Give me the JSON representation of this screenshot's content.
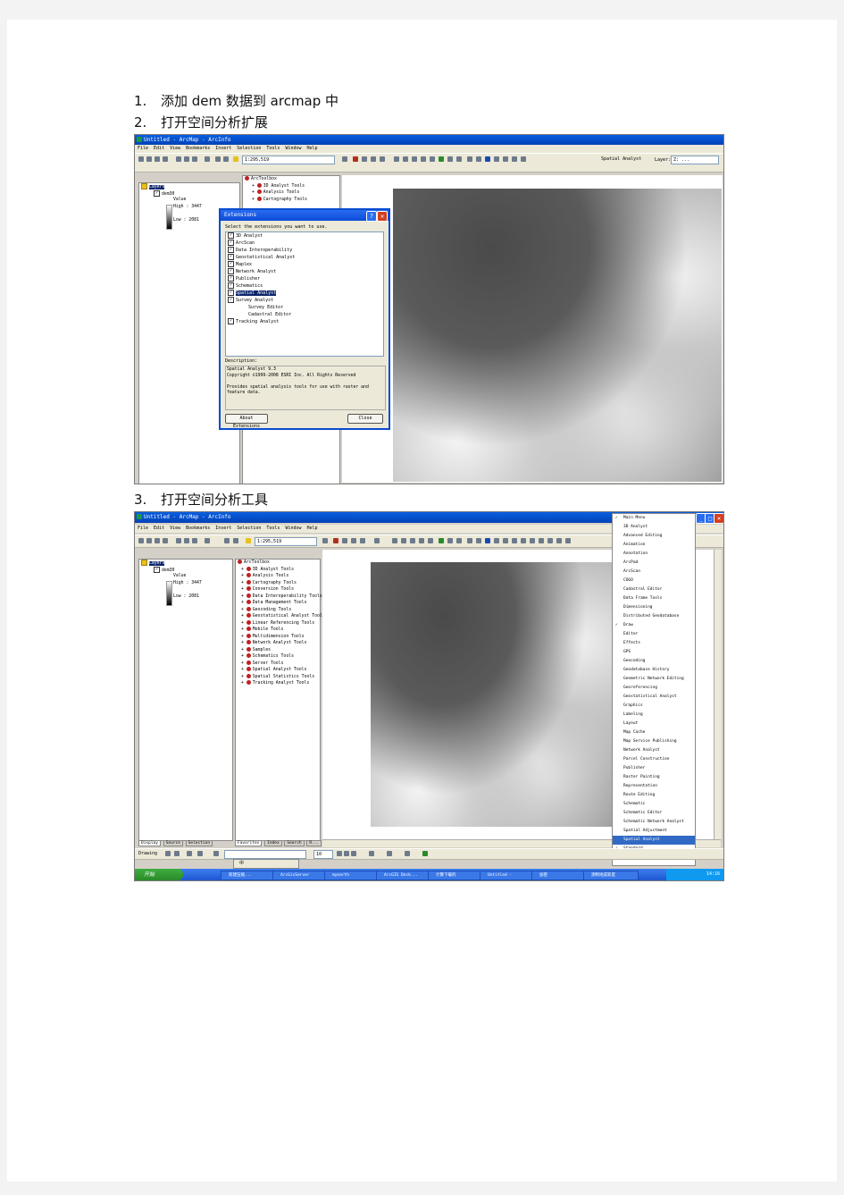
{
  "steps": [
    {
      "num": "1.",
      "text": "添加 dem 数据到 arcmap 中"
    },
    {
      "num": "2.",
      "text": "打开空间分析扩展"
    },
    {
      "num": "3.",
      "text": "打开空间分析工具"
    }
  ],
  "shot1": {
    "title": "Untitled - ArcMap - ArcInfo",
    "menu": [
      "File",
      "Edit",
      "View",
      "Bookmarks",
      "Insert",
      "Selection",
      "Tools",
      "Window",
      "Help"
    ],
    "scale": "1:295,519",
    "spatial_analyst_label": "Spatial Analyst",
    "layer_label": "Layer:",
    "layer_value": "Z: ...",
    "toc": {
      "root": "Layers",
      "layer": "dem30",
      "value_label": "Value",
      "high": "High : 3447",
      "low": "Low : 2081"
    },
    "toolbox": {
      "root": "ArcToolbox",
      "items": [
        "3D Analyst Tools",
        "Analysis Tools",
        "Cartography Tools"
      ]
    },
    "dialog": {
      "title": "Extensions",
      "prompt": "Select the extensions you want to use.",
      "extensions": [
        {
          "label": "3D Analyst",
          "checked": true,
          "indent": 0
        },
        {
          "label": "ArcScan",
          "checked": true,
          "indent": 0
        },
        {
          "label": "Data Interoperability",
          "checked": true,
          "indent": 0
        },
        {
          "label": "Geostatistical Analyst",
          "checked": true,
          "indent": 0
        },
        {
          "label": "Maplex",
          "checked": true,
          "indent": 0
        },
        {
          "label": "Network Analyst",
          "checked": true,
          "indent": 0
        },
        {
          "label": "Publisher",
          "checked": true,
          "indent": 0
        },
        {
          "label": "Schematics",
          "checked": true,
          "indent": 0
        },
        {
          "label": "Spatial Analyst",
          "checked": true,
          "indent": 0,
          "selected": true
        },
        {
          "label": "Survey Analyst",
          "checked": true,
          "indent": 0
        },
        {
          "label": "Survey Editor",
          "checked": false,
          "indent": 1
        },
        {
          "label": "Cadastral Editor",
          "checked": false,
          "indent": 1
        },
        {
          "label": "Tracking Analyst",
          "checked": true,
          "indent": 0
        }
      ],
      "description_label": "Description:",
      "description_lines": [
        "Spatial Analyst 9.3",
        "Copyright ©1999-2008 ESRI Inc. All Rights Reserved",
        "",
        "Provides spatial analysis tools for use with raster and feature data."
      ],
      "about_button": "About Extensions",
      "close_button": "Close"
    }
  },
  "shot2": {
    "title": "Untitled - ArcMap - ArcInfo",
    "menu": [
      "File",
      "Edit",
      "View",
      "Bookmarks",
      "Insert",
      "Selection",
      "Tools",
      "Window",
      "Help"
    ],
    "scale": "1:295,519",
    "toc": {
      "root": "Layers",
      "layer": "dem30",
      "value_label": "Value",
      "high": "High : 3447",
      "low": "Low : 2081"
    },
    "toc_tabs": [
      "Display",
      "Source",
      "Selection"
    ],
    "toolbox": {
      "root": "ArcToolbox",
      "items": [
        "3D Analyst Tools",
        "Analysis Tools",
        "Cartography Tools",
        "Conversion Tools",
        "Data Interoperability Tools",
        "Data Management Tools",
        "Geocoding Tools",
        "Geostatistical Analyst Tools",
        "Linear Referencing Tools",
        "Mobile Tools",
        "Multidimension Tools",
        "Network Analyst Tools",
        "Samples",
        "Schematics Tools",
        "Server Tools",
        "Spatial Analyst Tools",
        "Spatial Statistics Tools",
        "Tracking Analyst Tools"
      ]
    },
    "toolbox_tabs": [
      "Favorites",
      "Index",
      "Search",
      "R..."
    ],
    "toolbar_menu": [
      {
        "label": "Main Menu",
        "checked": true
      },
      {
        "label": "3D Analyst",
        "checked": false
      },
      {
        "label": "Advanced Editing",
        "checked": false
      },
      {
        "label": "Animation",
        "checked": false
      },
      {
        "label": "Annotation",
        "checked": false
      },
      {
        "label": "ArcPad",
        "checked": false
      },
      {
        "label": "ArcScan",
        "checked": false
      },
      {
        "label": "COGO",
        "checked": false
      },
      {
        "label": "Cadastral Editor",
        "checked": false
      },
      {
        "label": "Data Frame Tools",
        "checked": false
      },
      {
        "label": "Dimensioning",
        "checked": false
      },
      {
        "label": "Distributed Geodatabase",
        "checked": false
      },
      {
        "label": "Draw",
        "checked": true
      },
      {
        "label": "Editor",
        "checked": false
      },
      {
        "label": "Effects",
        "checked": false
      },
      {
        "label": "GPS",
        "checked": false
      },
      {
        "label": "Geocoding",
        "checked": false
      },
      {
        "label": "Geodatabase History",
        "checked": false
      },
      {
        "label": "Geometric Network Editing",
        "checked": false
      },
      {
        "label": "Georeferencing",
        "checked": false
      },
      {
        "label": "Geostatistical Analyst",
        "checked": false
      },
      {
        "label": "Graphics",
        "checked": false
      },
      {
        "label": "Labeling",
        "checked": false
      },
      {
        "label": "Layout",
        "checked": false
      },
      {
        "label": "Map Cache",
        "checked": false
      },
      {
        "label": "Map Service Publishing",
        "checked": false
      },
      {
        "label": "Network Analyst",
        "checked": false
      },
      {
        "label": "Parcel Construction",
        "checked": false
      },
      {
        "label": "Publisher",
        "checked": false
      },
      {
        "label": "Raster Painting",
        "checked": false
      },
      {
        "label": "Representation",
        "checked": false
      },
      {
        "label": "Route Editing",
        "checked": false
      },
      {
        "label": "Schematic",
        "checked": false
      },
      {
        "label": "Schematic Editor",
        "checked": false
      },
      {
        "label": "Schematic Network Analyst",
        "checked": false
      },
      {
        "label": "Spatial Adjustment",
        "checked": false
      },
      {
        "label": "Spatial Analyst",
        "checked": false,
        "selected": true
      },
      {
        "label": "Standard",
        "checked": true
      }
    ],
    "drawing_label": "Drawing",
    "font_size": "10",
    "ime_text": "中",
    "start_button": "开始",
    "taskbar_items": [
      "新建压缩... ",
      "ArcGisServer",
      "myearth",
      "ArcGIS Desk...",
      "计算下载的",
      "Untitled -",
      "加密",
      "测制地成新度"
    ],
    "clock": "14:16"
  }
}
